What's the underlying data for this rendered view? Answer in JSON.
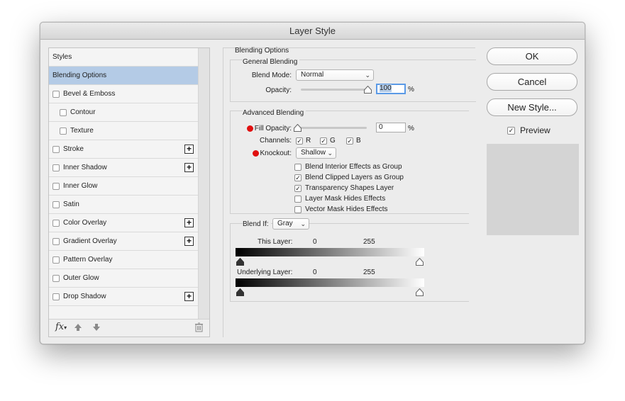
{
  "window": {
    "title": "Layer Style"
  },
  "styles_panel": {
    "items": [
      {
        "label": "Styles",
        "checkbox": false,
        "plus": false,
        "indent": 0,
        "selected": false
      },
      {
        "label": "Blending Options",
        "checkbox": false,
        "plus": false,
        "indent": 0,
        "selected": true
      },
      {
        "label": "Bevel & Emboss",
        "checkbox": true,
        "plus": false,
        "indent": 0,
        "selected": false
      },
      {
        "label": "Contour",
        "checkbox": true,
        "plus": false,
        "indent": 1,
        "selected": false
      },
      {
        "label": "Texture",
        "checkbox": true,
        "plus": false,
        "indent": 1,
        "selected": false
      },
      {
        "label": "Stroke",
        "checkbox": true,
        "plus": true,
        "indent": 0,
        "selected": false
      },
      {
        "label": "Inner Shadow",
        "checkbox": true,
        "plus": true,
        "indent": 0,
        "selected": false
      },
      {
        "label": "Inner Glow",
        "checkbox": true,
        "plus": false,
        "indent": 0,
        "selected": false
      },
      {
        "label": "Satin",
        "checkbox": true,
        "plus": false,
        "indent": 0,
        "selected": false
      },
      {
        "label": "Color Overlay",
        "checkbox": true,
        "plus": true,
        "indent": 0,
        "selected": false
      },
      {
        "label": "Gradient Overlay",
        "checkbox": true,
        "plus": true,
        "indent": 0,
        "selected": false
      },
      {
        "label": "Pattern Overlay",
        "checkbox": true,
        "plus": false,
        "indent": 0,
        "selected": false
      },
      {
        "label": "Outer Glow",
        "checkbox": true,
        "plus": false,
        "indent": 0,
        "selected": false
      },
      {
        "label": "Drop Shadow",
        "checkbox": true,
        "plus": true,
        "indent": 0,
        "selected": false
      }
    ],
    "plus_symbol": "+",
    "footer": {
      "fx_label": "fx",
      "up_icon": "arrow-up-icon",
      "down_icon": "arrow-down-icon",
      "trash_icon": "trash-icon"
    }
  },
  "blending_options": {
    "section_title": "Blending Options",
    "general": {
      "title": "General Blending",
      "blend_mode_label": "Blend Mode:",
      "blend_mode_value": "Normal",
      "opacity_label": "Opacity:",
      "opacity_value": "100",
      "opacity_unit": "%",
      "opacity_level": 1.0
    },
    "advanced": {
      "title": "Advanced Blending",
      "fill_opacity_label": "Fill Opacity:",
      "fill_opacity_value": "0",
      "fill_opacity_unit": "%",
      "fill_opacity_level": 0.0,
      "channels_label": "Channels:",
      "channels": [
        {
          "label": "R",
          "checked": true
        },
        {
          "label": "G",
          "checked": true
        },
        {
          "label": "B",
          "checked": true
        }
      ],
      "knockout_label": "Knockout:",
      "knockout_value": "Shallow",
      "options": [
        {
          "label": "Blend Interior Effects as Group",
          "checked": false
        },
        {
          "label": "Blend Clipped Layers as Group",
          "checked": true
        },
        {
          "label": "Transparency Shapes Layer",
          "checked": true
        },
        {
          "label": "Layer Mask Hides Effects",
          "checked": false
        },
        {
          "label": "Vector Mask Hides Effects",
          "checked": false
        }
      ]
    },
    "blend_if": {
      "label": "Blend If:",
      "value": "Gray",
      "this_layer_label": "This Layer:",
      "this_layer_min": "0",
      "this_layer_max": "255",
      "underlying_label": "Underlying Layer:",
      "underlying_min": "0",
      "underlying_max": "255"
    }
  },
  "buttons": {
    "ok": "OK",
    "cancel": "Cancel",
    "new_style": "New Style...",
    "preview_label": "Preview",
    "preview_checked": true
  },
  "colors": {
    "selection": "#b4cbe6",
    "focus_ring": "#5b9ae6",
    "annotation_dot": "#e01010",
    "preview_swatch": "#d4d4d4"
  }
}
